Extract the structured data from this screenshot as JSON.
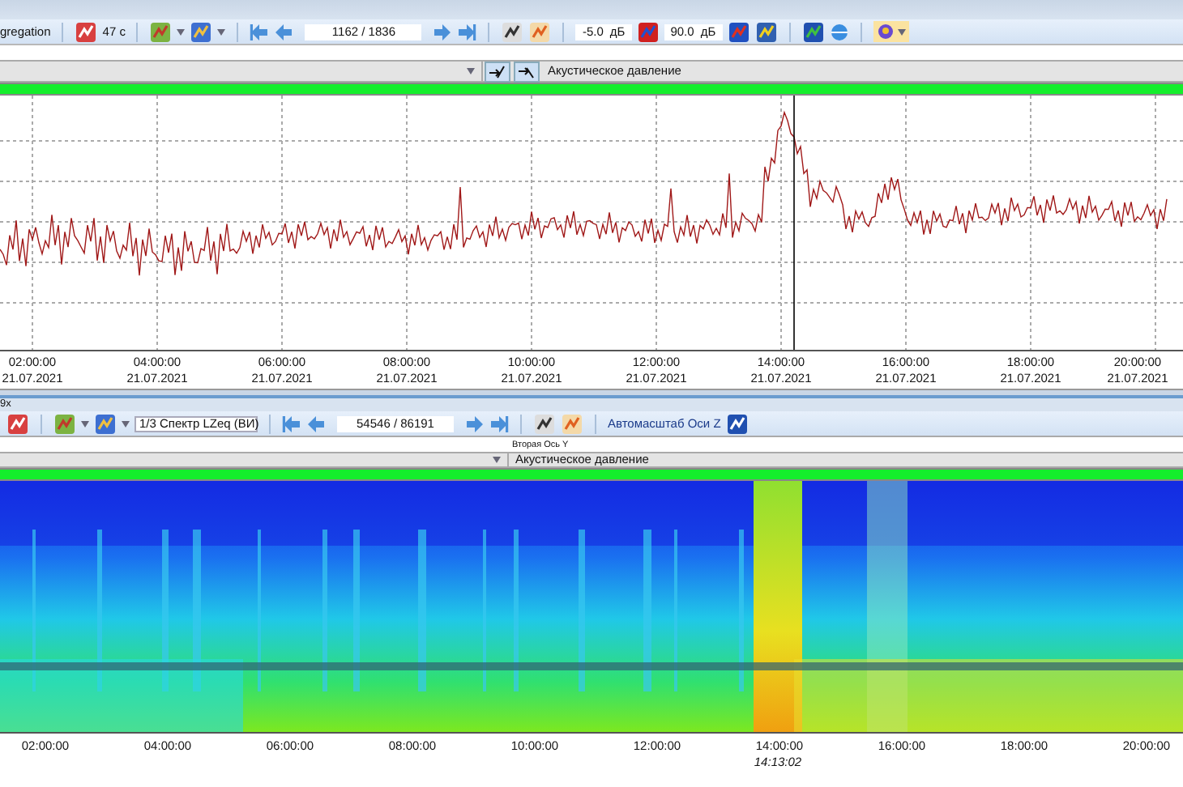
{
  "top_panel": {
    "toolbar": {
      "aggregation_label": "gregation",
      "interval": "47 с",
      "record_field": "1162 / 1836",
      "min_level": "-5.0",
      "min_unit": "дБ",
      "max_level": "90.0",
      "max_unit": "дБ"
    },
    "axis_selector": {
      "y_label": "Акустическое давление"
    },
    "time_axis": [
      {
        "time": "02:00:00",
        "date": "21.07.2021"
      },
      {
        "time": "04:00:00",
        "date": "21.07.2021"
      },
      {
        "time": "06:00:00",
        "date": "21.07.2021"
      },
      {
        "time": "08:00:00",
        "date": "21.07.2021"
      },
      {
        "time": "10:00:00",
        "date": "21.07.2021"
      },
      {
        "time": "12:00:00",
        "date": "21.07.2021"
      },
      {
        "time": "14:00:00",
        "date": "21.07.2021"
      },
      {
        "time": "16:00:00",
        "date": "21.07.2021"
      },
      {
        "time": "18:00:00",
        "date": "21.07.2021"
      },
      {
        "time": "20:00:00",
        "date": "21.07.2021"
      }
    ]
  },
  "bottom_panel": {
    "title": "9x",
    "toolbar": {
      "spectrum_select": "1/3 Спектр LZeq (ВИ)",
      "record_field": "54546 / 86191",
      "autoscale_label": "Автомасштаб Оси Z"
    },
    "axis_selector": {
      "second_axis_caption": "Вторая Ось Y",
      "y_label": "Акустическое давление"
    },
    "time_axis": [
      {
        "time": "02:00:00"
      },
      {
        "time": "04:00:00"
      },
      {
        "time": "06:00:00"
      },
      {
        "time": "08:00:00"
      },
      {
        "time": "10:00:00"
      },
      {
        "time": "12:00:00"
      },
      {
        "time": "14:00:00"
      },
      {
        "time": "16:00:00"
      },
      {
        "time": "18:00:00"
      },
      {
        "time": "20:00:00"
      }
    ],
    "cursor_time": "14:13:02"
  }
}
